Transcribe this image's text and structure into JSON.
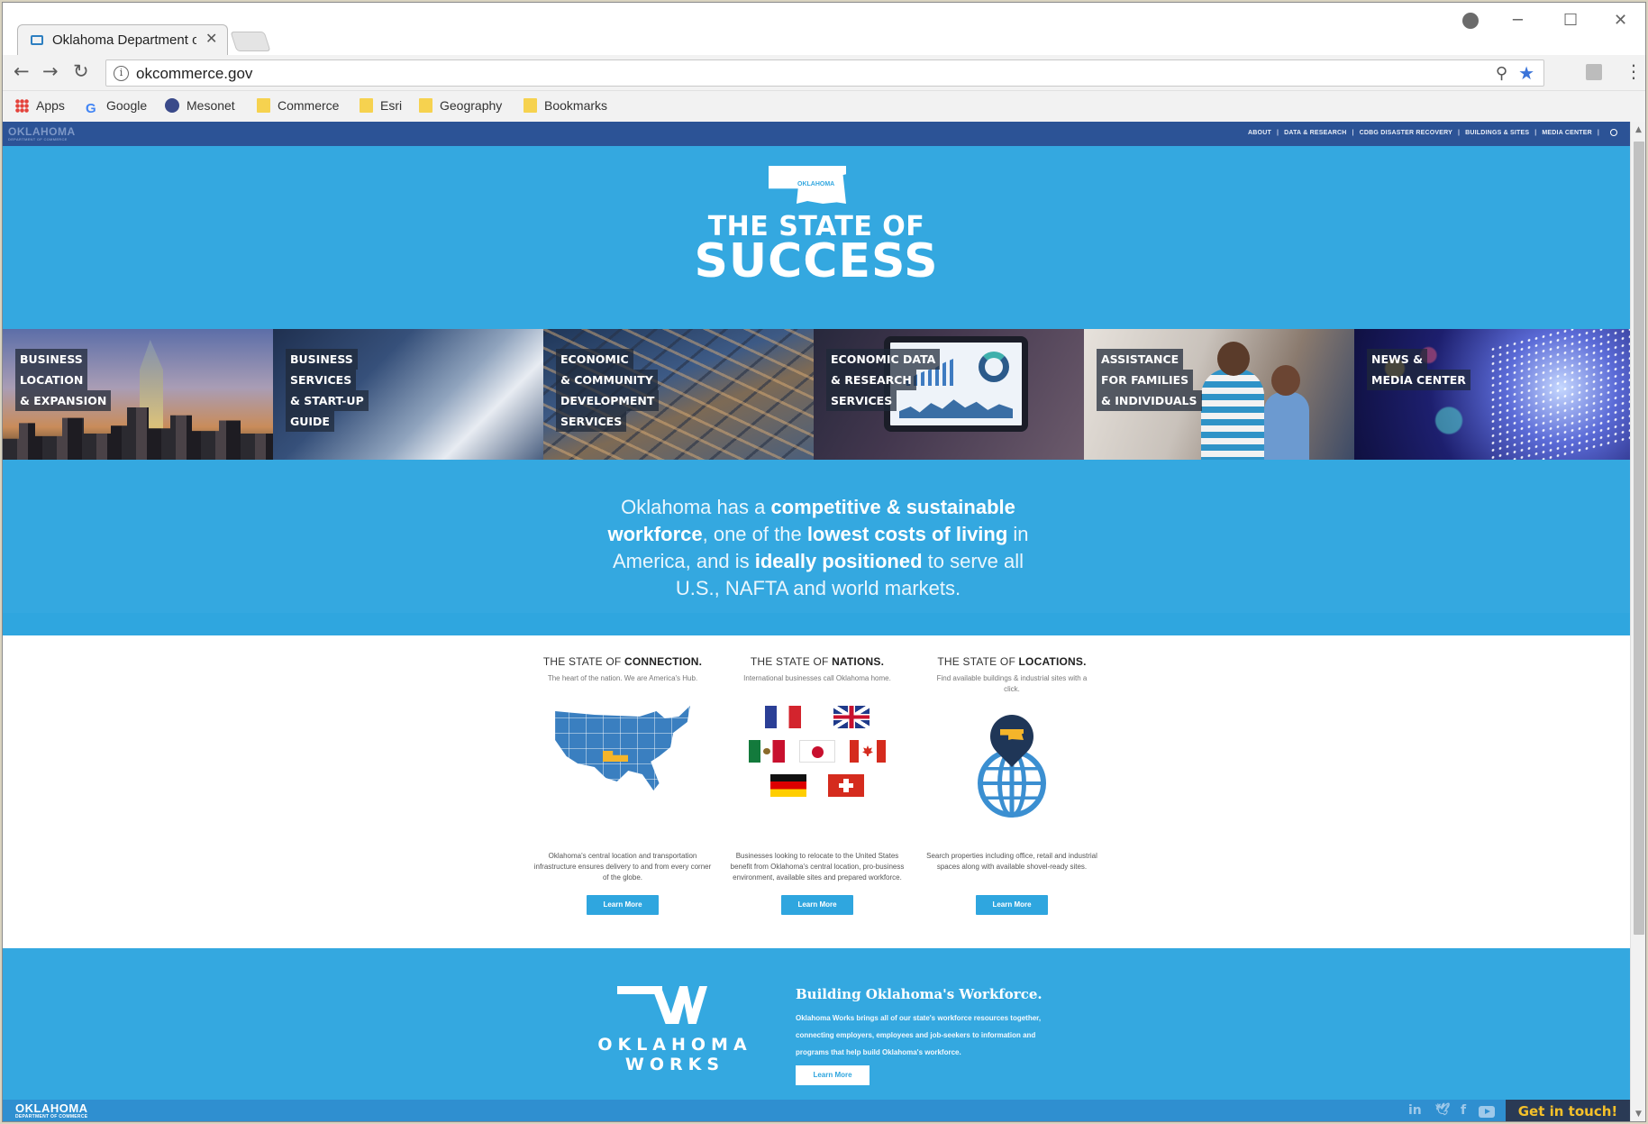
{
  "browser": {
    "tab_title": "Oklahoma Department o",
    "url": "okcommerce.gov",
    "bookmarks": [
      {
        "label": "Apps",
        "icon": "apps-grid-icon"
      },
      {
        "label": "Google",
        "icon": "google-icon"
      },
      {
        "label": "Mesonet",
        "icon": "mesonet-icon"
      },
      {
        "label": "Commerce",
        "icon": "folder-icon"
      },
      {
        "label": "Esri",
        "icon": "folder-icon"
      },
      {
        "label": "Geography",
        "icon": "folder-icon"
      },
      {
        "label": "Bookmarks",
        "icon": "folder-icon"
      }
    ]
  },
  "site": {
    "topbar": {
      "logo": "OKLAHOMA",
      "logo_sub": "DEPARTMENT OF COMMERCE",
      "nav": [
        "ABOUT",
        "DATA & RESEARCH",
        "CDBG DISASTER RECOVERY",
        "BUILDINGS & SITES",
        "MEDIA CENTER"
      ]
    },
    "hero": {
      "flag_text": "OKLAHOMA",
      "line1": "THE STATE OF",
      "line2": "SUCCESS"
    },
    "tiles": [
      {
        "lines": [
          "BUSINESS",
          "LOCATION",
          "& EXPANSION"
        ]
      },
      {
        "lines": [
          "BUSINESS",
          "SERVICES",
          "& START-UP",
          "GUIDE"
        ]
      },
      {
        "lines": [
          "ECONOMIC",
          "& COMMUNITY",
          "DEVELOPMENT",
          "SERVICES"
        ]
      },
      {
        "lines": [
          "ECONOMIC DATA",
          "& RESEARCH",
          "SERVICES"
        ]
      },
      {
        "lines": [
          "ASSISTANCE",
          "FOR FAMILIES",
          "& INDIVIDUALS"
        ]
      },
      {
        "lines": [
          "NEWS &",
          "MEDIA CENTER"
        ]
      }
    ],
    "tagline": {
      "p1": "Oklahoma has a ",
      "b1": "competitive & sustainable workforce",
      "p2": ", one of the ",
      "b2": "lowest costs of living",
      "p3": " in America, and is ",
      "b3": "ideally positioned",
      "p4": " to serve all U.S., NAFTA and world markets."
    },
    "features": [
      {
        "title_prefix": "THE STATE OF ",
        "title_bold": "CONNECTION.",
        "subtitle": "The heart of the nation. We are America's Hub.",
        "description": "Oklahoma's central location and transportation infrastructure ensures delivery to and from every corner of the globe.",
        "button": "Learn More"
      },
      {
        "title_prefix": "THE STATE OF ",
        "title_bold": "NATIONS.",
        "subtitle": "International businesses call Oklahoma home.",
        "description": "Businesses looking to relocate to the United States benefit from Oklahoma's central location, pro-business environment, available sites and prepared workforce.",
        "button": "Learn More"
      },
      {
        "title_prefix": "THE STATE OF ",
        "title_bold": "LOCATIONS.",
        "subtitle": "Find available buildings & industrial sites with a click.",
        "description": "Search properties including office, retail and industrial spaces along with available shovel-ready sites.",
        "button": "Learn More"
      }
    ],
    "works": {
      "name_line1": "OKLAHOMA",
      "name_line2": "WORKS",
      "title": "Building Oklahoma's Workforce.",
      "body": "Oklahoma Works brings all of our state's workforce resources together, connecting employers, employees and job-seekers to information and programs that help build Oklahoma's workforce.",
      "button": "Learn More"
    },
    "footer": {
      "logo": "OKLAHOMA",
      "logo_sub": "DEPARTMENT OF COMMERCE",
      "linkedin": "in",
      "twitter": "🐦",
      "facebook": "f",
      "cta": "Get in touch!"
    }
  }
}
